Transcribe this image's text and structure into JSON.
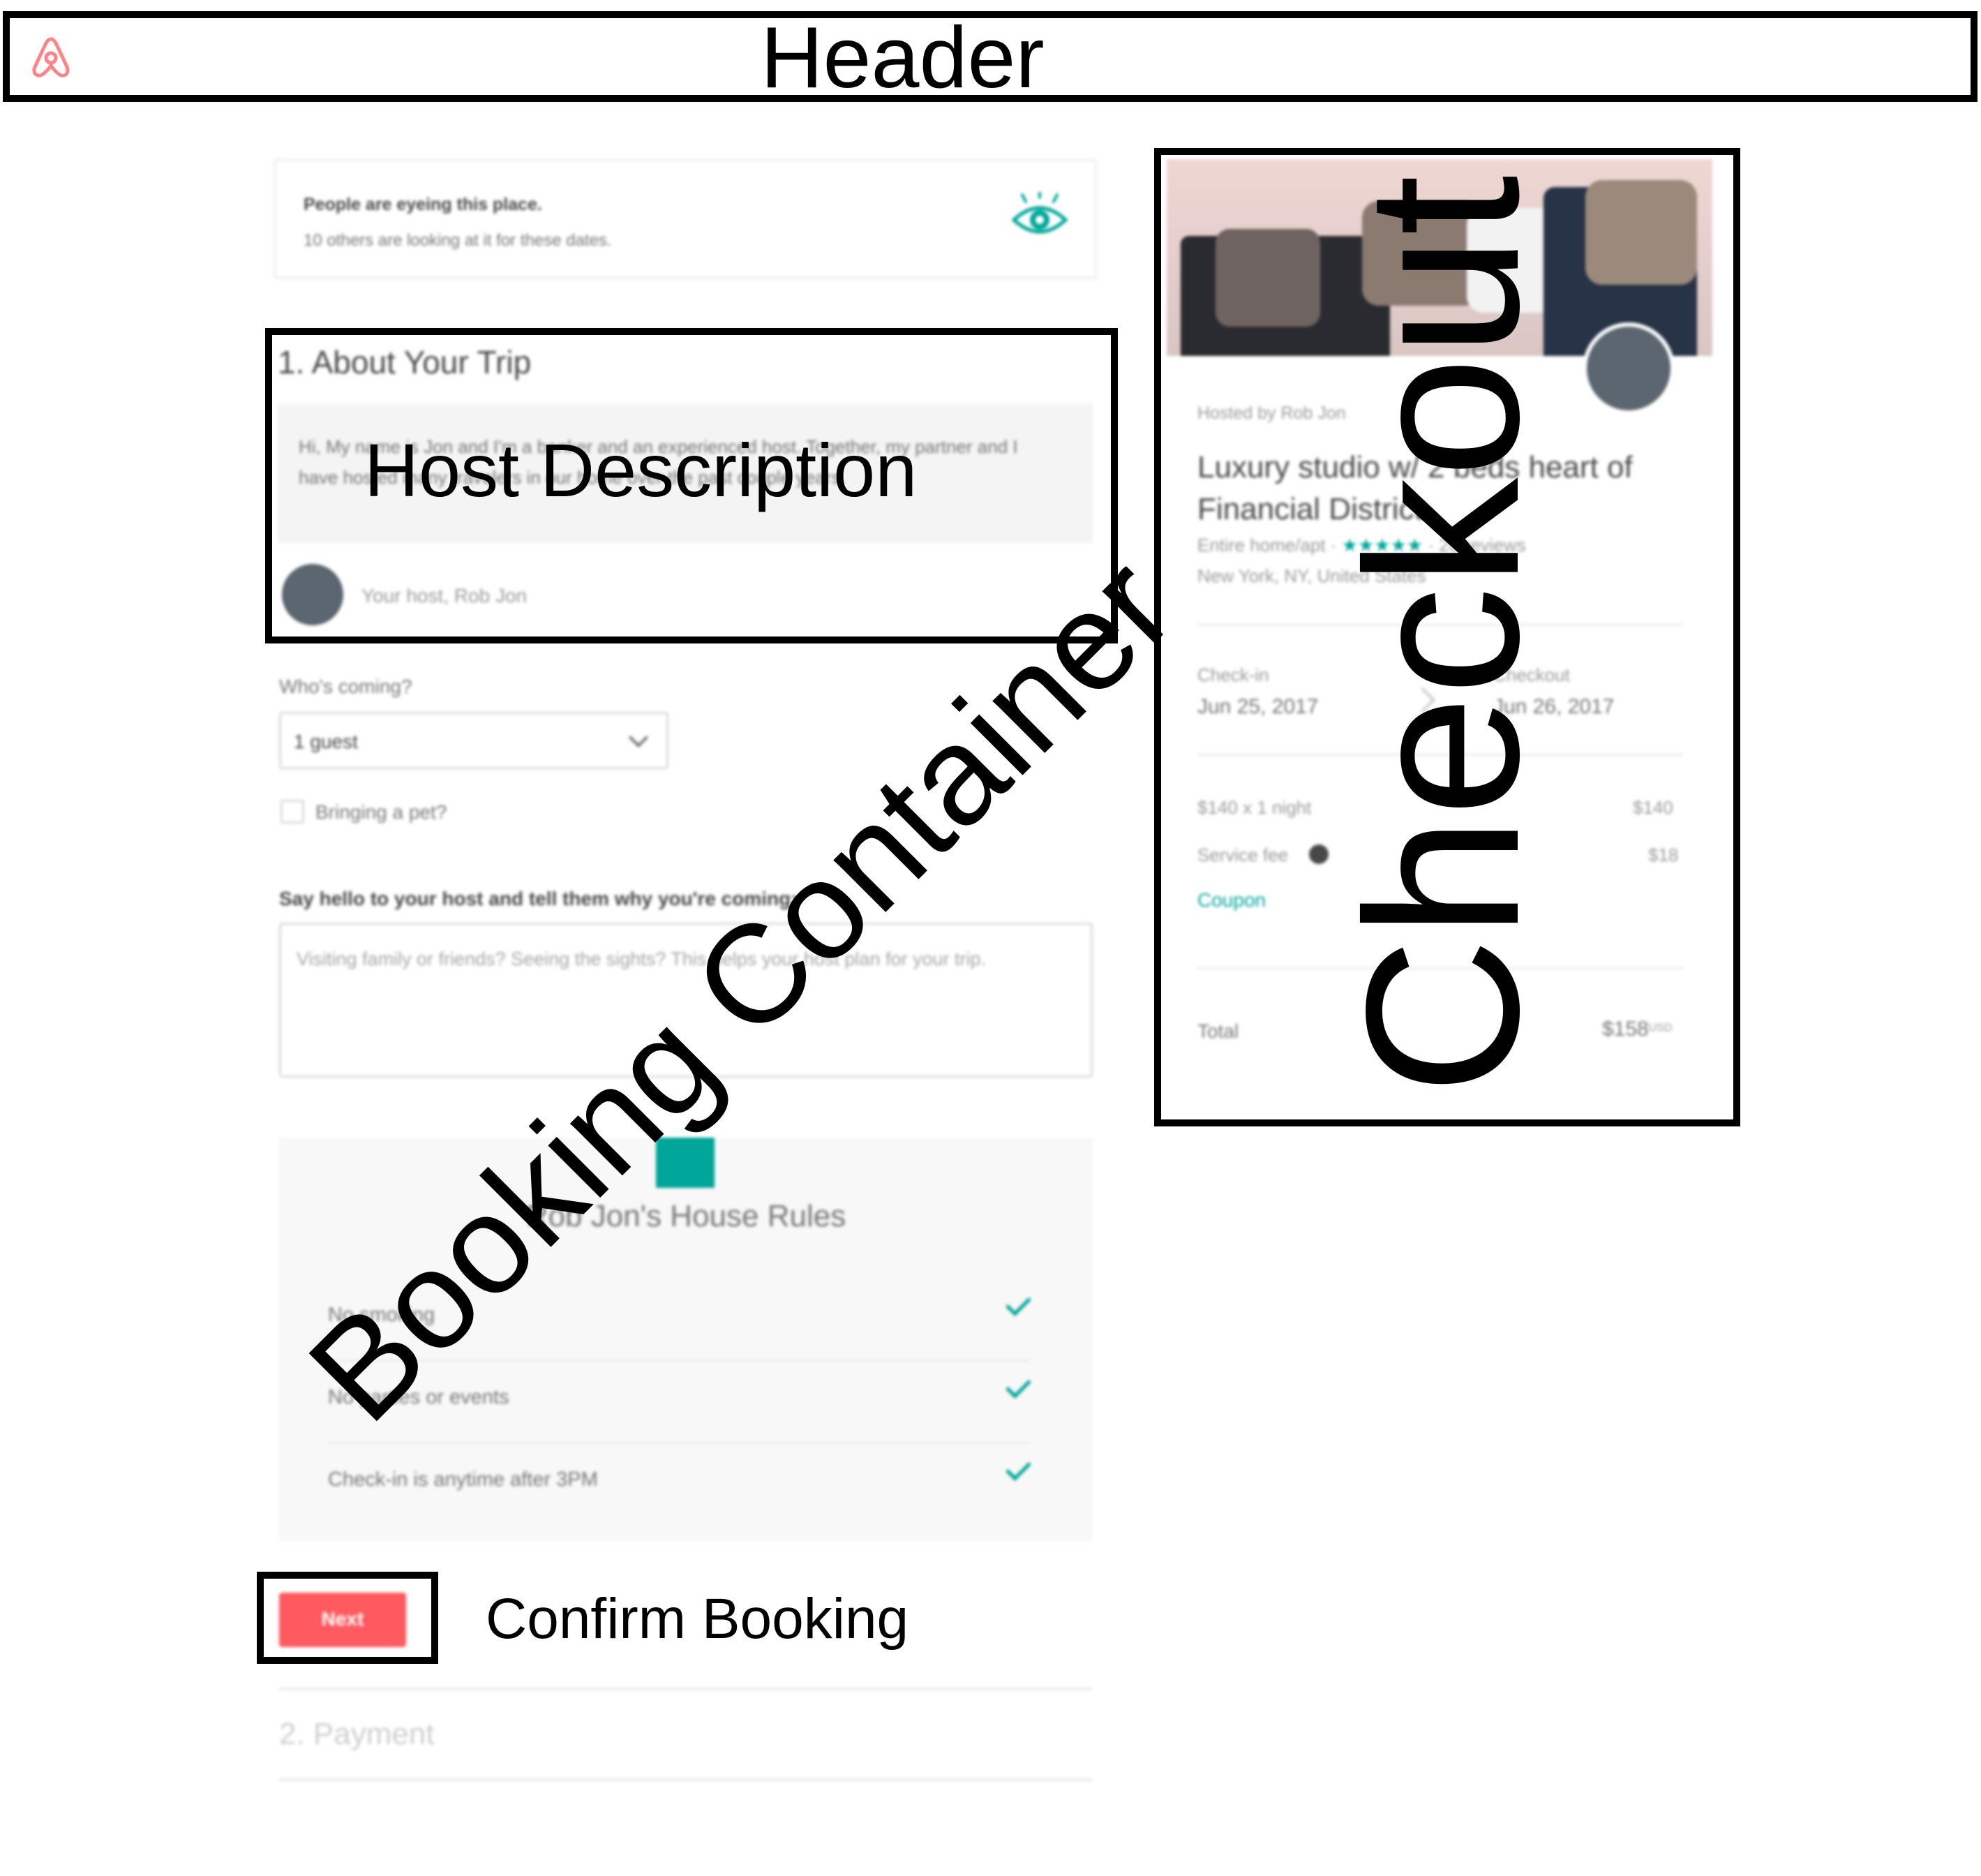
{
  "header": {
    "label": "Header",
    "logo_icon": "airbnb-logo-icon"
  },
  "notice": {
    "title": "People are eyeing this place.",
    "subtitle": "10 others are looking at it for these dates.",
    "icon": "eye-icon"
  },
  "trip": {
    "heading": "1. About Your Trip",
    "host_message": "Hi, My name is Jon and I'm a banker and an experienced host. Together, my partner and I have hosted many travelers in our home over the past couple years.",
    "host_label": "Your host, Rob Jon",
    "guests_label": "Who's coming?",
    "guests_value": "1 guest",
    "pet_label": "Bringing a pet?",
    "message_label": "Say hello to your host and tell them why you're coming:",
    "message_placeholder": "Visiting family or friends? Seeing the sights? This helps your host plan for your trip."
  },
  "house_rules": {
    "title": "Rob Jon's House Rules",
    "rules": [
      "No smoking",
      "No parties or events",
      "Check-in is anytime after 3PM"
    ]
  },
  "actions": {
    "next_label": "Next"
  },
  "payment": {
    "heading": "2. Payment"
  },
  "checkout": {
    "hosted_by": "Hosted by Rob Jon",
    "listing_title": "Luxury studio w/ 2 beds heart of Financial District",
    "listing_type": "Entire home/apt",
    "stars": "★★★★★",
    "reviews": "20 reviews",
    "location": "New York, NY, United States",
    "checkin_label": "Check-in",
    "checkin_date": "Jun 25, 2017",
    "checkout_label": "Checkout",
    "checkout_date": "Jun 26, 2017",
    "nightly_label": "$140 x 1 night",
    "nightly_value": "$140",
    "fee_label": "Service fee",
    "fee_value": "$18",
    "coupon_label": "Coupon",
    "total_label": "Total",
    "total_value": "$158",
    "total_currency": "USD"
  },
  "annotations": {
    "host_description": "Host Description",
    "booking_container": "Booking Container",
    "checkout": "Checkout",
    "confirm_booking": "Confirm Booking"
  },
  "colors": {
    "accent": "#00a699",
    "brand": "#ff5a5f"
  }
}
